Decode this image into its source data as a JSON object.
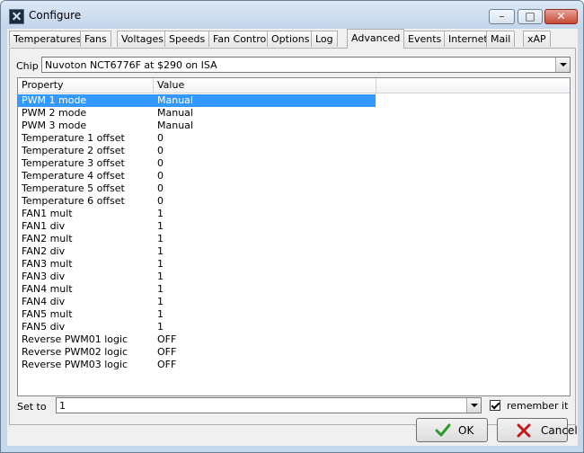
{
  "window": {
    "title": "Configure"
  },
  "tabs": [
    {
      "label": "Temperatures"
    },
    {
      "label": "Fans"
    },
    {
      "label": "Voltages"
    },
    {
      "label": "Speeds"
    },
    {
      "label": "Fan Control"
    },
    {
      "label": "Options"
    },
    {
      "label": "Log"
    },
    {
      "label": "Advanced",
      "active": true
    },
    {
      "label": "Events"
    },
    {
      "label": "Internet"
    },
    {
      "label": "Mail"
    },
    {
      "label": "xAP"
    }
  ],
  "chip": {
    "label": "Chip",
    "value": "Nuvoton NCT6776F at $290 on ISA"
  },
  "list": {
    "columns": [
      "Property",
      "Value"
    ],
    "selected_index": 0,
    "rows": [
      {
        "property": "PWM 1 mode",
        "value": "Manual"
      },
      {
        "property": "PWM 2 mode",
        "value": "Manual"
      },
      {
        "property": "PWM 3 mode",
        "value": "Manual"
      },
      {
        "property": "Temperature 1 offset",
        "value": "0"
      },
      {
        "property": "Temperature 2 offset",
        "value": "0"
      },
      {
        "property": "Temperature 3 offset",
        "value": "0"
      },
      {
        "property": "Temperature 4 offset",
        "value": "0"
      },
      {
        "property": "Temperature 5 offset",
        "value": "0"
      },
      {
        "property": "Temperature 6 offset",
        "value": "0"
      },
      {
        "property": "FAN1 mult",
        "value": "1"
      },
      {
        "property": "FAN1 div",
        "value": "1"
      },
      {
        "property": "FAN2 mult",
        "value": "1"
      },
      {
        "property": "FAN2 div",
        "value": "1"
      },
      {
        "property": "FAN3 mult",
        "value": "1"
      },
      {
        "property": "FAN3 div",
        "value": "1"
      },
      {
        "property": "FAN4 mult",
        "value": "1"
      },
      {
        "property": "FAN4 div",
        "value": "1"
      },
      {
        "property": "FAN5 mult",
        "value": "1"
      },
      {
        "property": "FAN5 div",
        "value": "1"
      },
      {
        "property": "Reverse PWM01 logic",
        "value": "OFF"
      },
      {
        "property": "Reverse PWM02 logic",
        "value": "OFF"
      },
      {
        "property": "Reverse PWM03 logic",
        "value": "OFF"
      }
    ]
  },
  "set_to": {
    "label": "Set to",
    "value": "1"
  },
  "remember": {
    "label": "remember it",
    "checked": true
  },
  "buttons": {
    "ok": "OK",
    "cancel": "Cancel"
  },
  "colors": {
    "selection": "#3399ff",
    "ok_icon": "#2e9a2e",
    "cancel_icon": "#c41818"
  },
  "icons": {
    "app": "fan-app-icon",
    "ok": "checkmark-icon",
    "cancel": "x-mark-icon"
  }
}
